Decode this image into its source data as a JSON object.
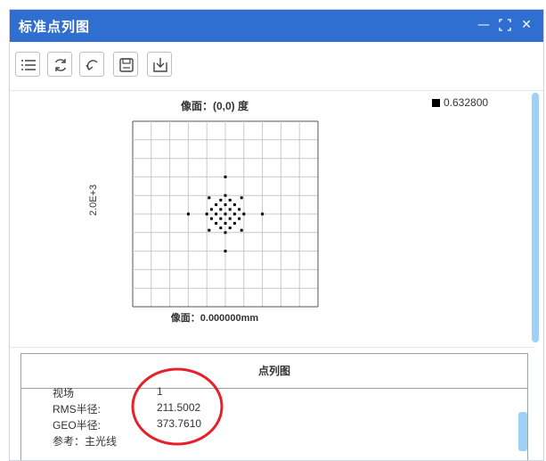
{
  "window": {
    "title": "标准点列图"
  },
  "toolbar": {
    "icons": [
      "list-icon",
      "refresh-icon",
      "undo-icon",
      "save-icon",
      "download-icon"
    ]
  },
  "plot": {
    "title": "像面：(0,0) 度",
    "legend_label": "0.632800",
    "ylabel": "2.0E+3",
    "xlabel": "像面：0.000000mm"
  },
  "chart_data": {
    "type": "scatter",
    "title": "像面：(0,0) 度",
    "xlabel": "像面：0.000000mm",
    "ylabel": "2.0E+3",
    "series": [
      {
        "name": "0.632800",
        "color": "#000000"
      }
    ],
    "xlim": [
      -2000,
      2000
    ],
    "ylim": [
      -2000,
      2000
    ],
    "grid": true,
    "legend": "top-right",
    "points": [
      [
        0,
        800
      ],
      [
        0,
        400
      ],
      [
        0,
        200
      ],
      [
        0,
        0
      ],
      [
        0,
        -200
      ],
      [
        0,
        -400
      ],
      [
        0,
        -800
      ],
      [
        -800,
        0
      ],
      [
        -400,
        0
      ],
      [
        -200,
        0
      ],
      [
        200,
        0
      ],
      [
        400,
        0
      ],
      [
        800,
        0
      ],
      [
        -350,
        350
      ],
      [
        350,
        350
      ],
      [
        -350,
        -350
      ],
      [
        350,
        -350
      ],
      [
        -200,
        200
      ],
      [
        200,
        200
      ],
      [
        -200,
        -200
      ],
      [
        200,
        -200
      ],
      [
        -100,
        100
      ],
      [
        100,
        100
      ],
      [
        -100,
        -100
      ],
      [
        100,
        -100
      ],
      [
        -300,
        100
      ],
      [
        300,
        100
      ],
      [
        -300,
        -100
      ],
      [
        300,
        -100
      ],
      [
        -100,
        300
      ],
      [
        100,
        300
      ],
      [
        -100,
        -300
      ],
      [
        100,
        -300
      ]
    ]
  },
  "info": {
    "header": "点列图",
    "rows": [
      {
        "label": "视场",
        "value": "1"
      },
      {
        "label": "RMS半径:",
        "value": "211.5002"
      },
      {
        "label": "GEO半径:",
        "value": "373.7610"
      },
      {
        "label": "参考：主光线",
        "value": ""
      }
    ]
  },
  "annotation": {
    "color": "#e8202a"
  }
}
